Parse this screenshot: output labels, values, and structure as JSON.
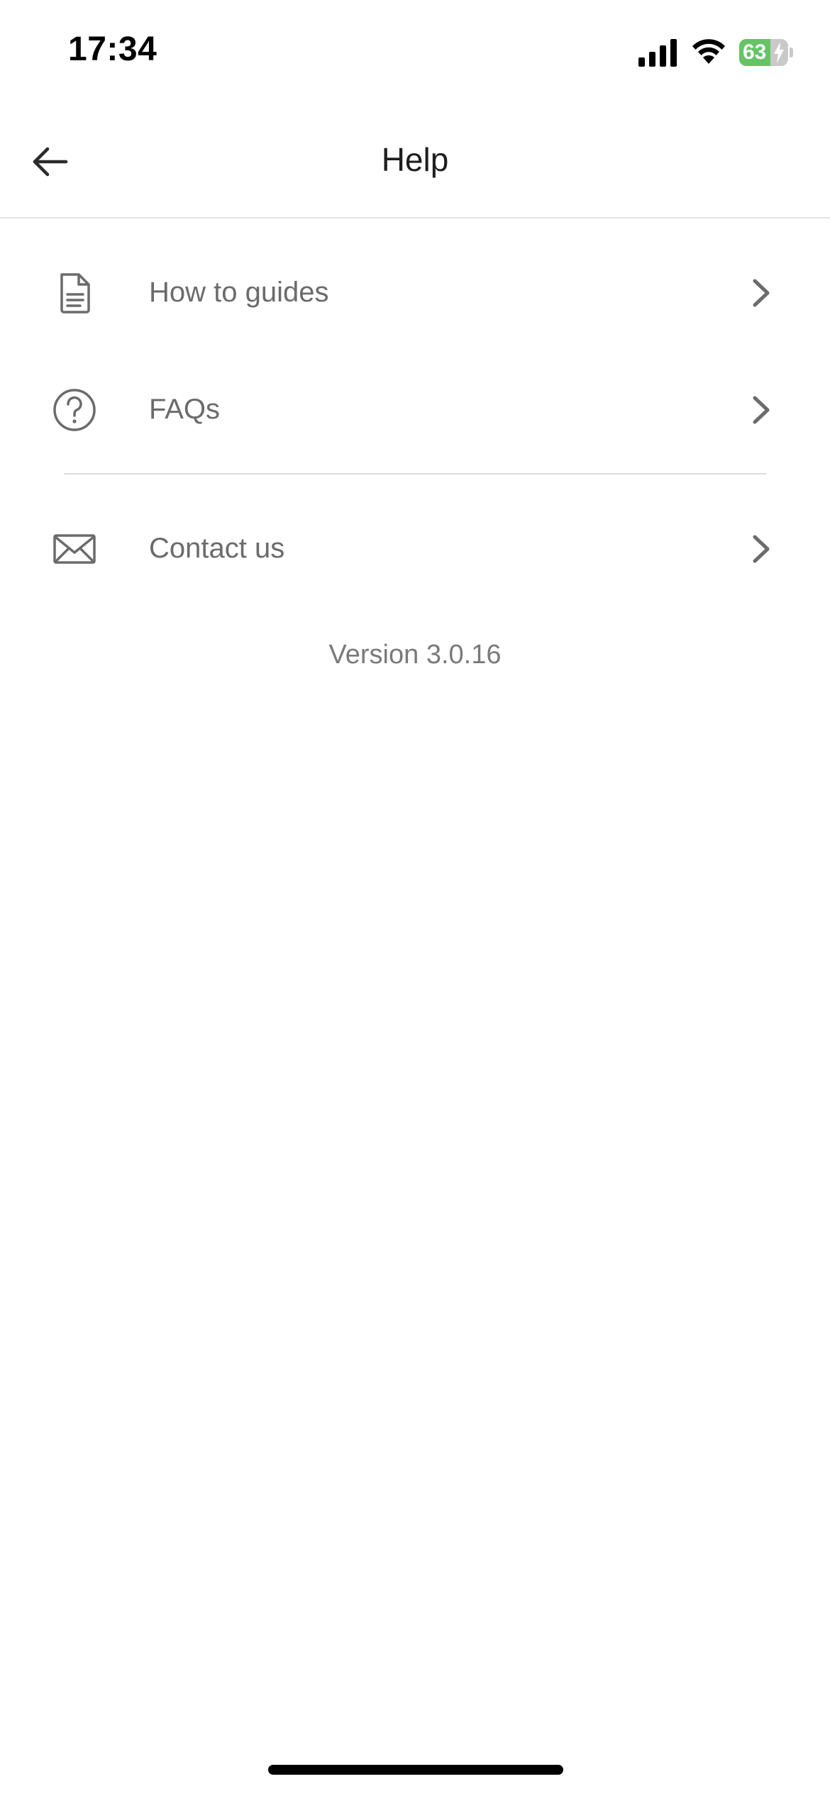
{
  "status_bar": {
    "time": "17:34",
    "battery_level": "63",
    "battery_fraction": 0.63,
    "battery_color": "#65c466",
    "icons": [
      "signal-icon",
      "wifi-icon",
      "battery-icon",
      "charging-bolt-icon"
    ]
  },
  "header": {
    "title": "Help",
    "back_icon": "arrow-left-icon"
  },
  "menu": {
    "items": [
      {
        "label": "How to guides",
        "icon": "document-icon"
      },
      {
        "label": "FAQs",
        "icon": "question-circle-icon"
      },
      {
        "label": "Contact us",
        "icon": "envelope-icon"
      }
    ],
    "chevron_icon": "chevron-right-icon"
  },
  "footer": {
    "version": "Version 3.0.16"
  },
  "colors": {
    "background": "#ffffff",
    "label": "#6b6b6b",
    "title": "#1e1e1e",
    "divider": "#dcdcdc",
    "version_text": "#7a7a7a"
  }
}
